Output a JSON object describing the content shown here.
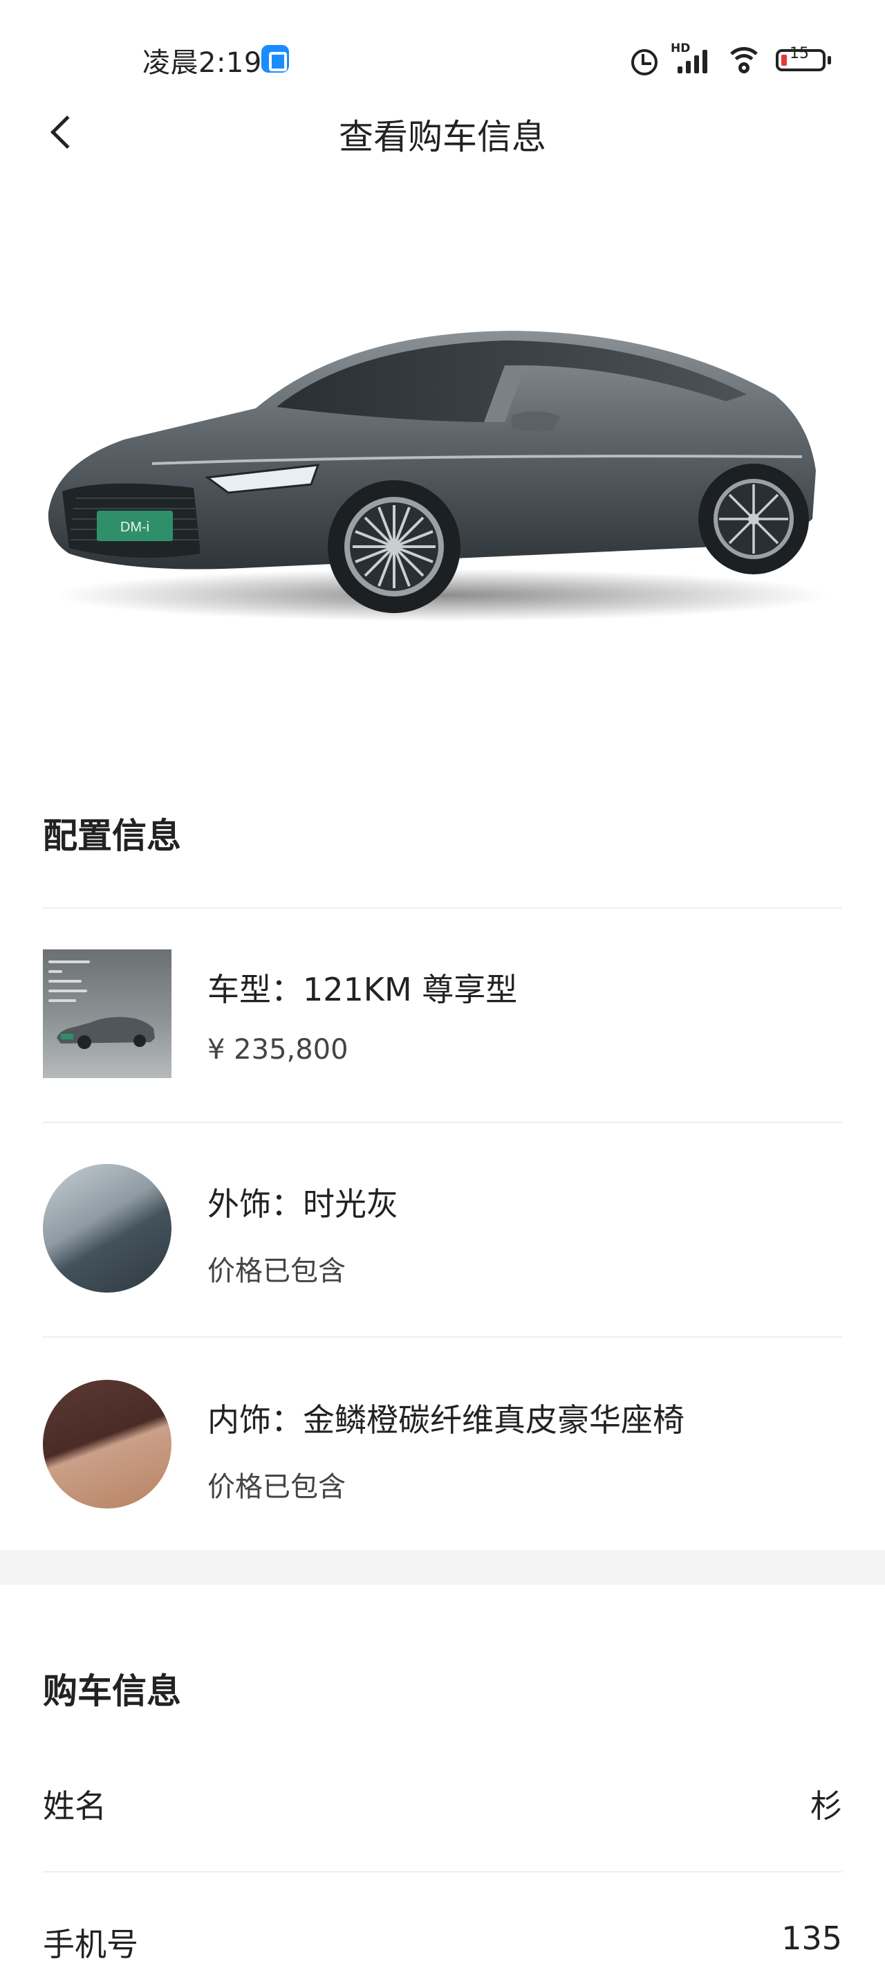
{
  "status_bar": {
    "time": "凌晨2:19",
    "signal_label": "HD",
    "battery": "15",
    "icons": [
      "app-notification-icon",
      "alarm-icon",
      "signal-icon",
      "wifi-icon",
      "battery-icon"
    ]
  },
  "nav": {
    "title": "查看购车信息",
    "back_icon": "chevron-left-icon"
  },
  "hero": {
    "badge_text": "DM-i"
  },
  "config": {
    "section_title": "配置信息",
    "items": [
      {
        "title": "车型：121KM 尊享型",
        "sub": "¥ 235,800",
        "thumb": "model-thumbnail"
      },
      {
        "title": "外饰：时光灰",
        "sub": "价格已包含",
        "thumb": "exterior-swatch",
        "color": "#6f7c84"
      },
      {
        "title": "内饰：金鳞橙碳纤维真皮豪华座椅",
        "sub": "价格已包含",
        "thumb": "interior-swatch",
        "color": "#b88264"
      }
    ]
  },
  "purchase": {
    "section_title": "购车信息",
    "rows": [
      {
        "label": "姓名",
        "value": "杉"
      },
      {
        "label": "手机号",
        "value": "135"
      }
    ]
  },
  "colors": {
    "text_primary": "#222222",
    "divider": "#eeeeee",
    "band": "#f3f3f3",
    "battery_low": "#e53935",
    "app_icon": "#1a8cff"
  }
}
